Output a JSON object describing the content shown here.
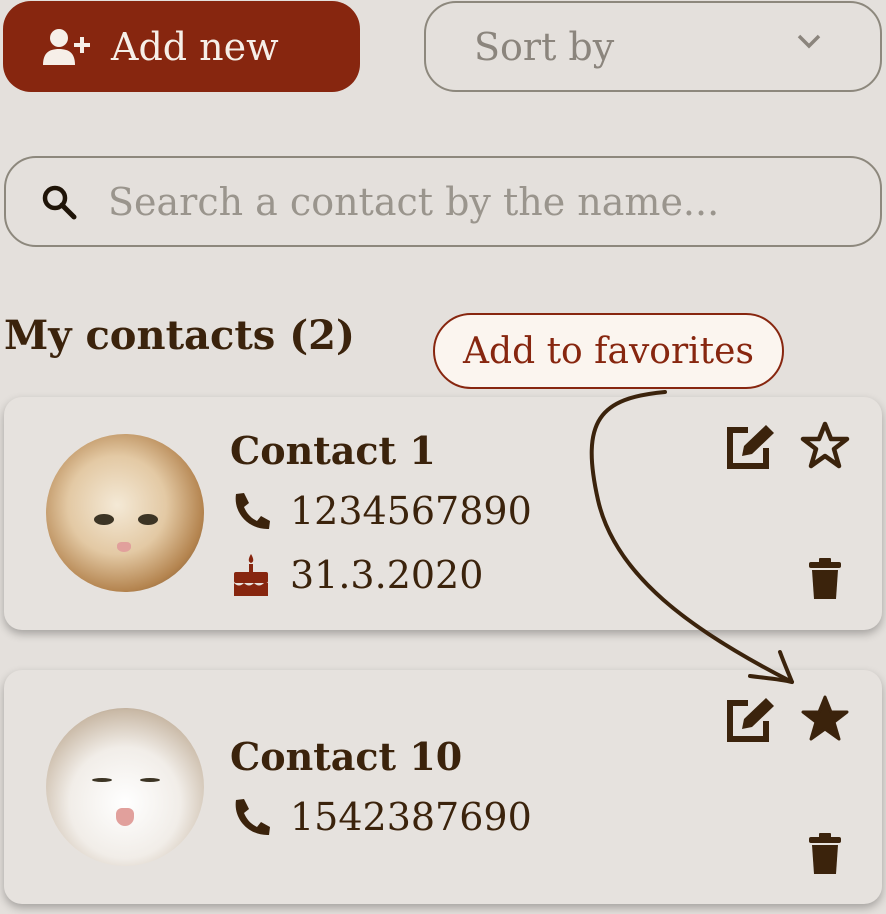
{
  "toolbar": {
    "add_label": "Add new",
    "sort_label": "Sort by"
  },
  "search": {
    "placeholder": "Search a contact by the name..."
  },
  "contacts_heading": "My contacts (2)",
  "tooltip": "Add to favorites",
  "contacts": [
    {
      "name": "Contact 1",
      "phone": "1234567890",
      "birthday": "31.3.2020",
      "favorite": false
    },
    {
      "name": "Contact 10",
      "phone": "1542387690",
      "favorite": true
    }
  ],
  "icons": {
    "add": "user-plus-icon",
    "sort": "chevron-down-icon",
    "search": "search-icon",
    "phone": "phone-icon",
    "birthday": "cake-icon",
    "edit": "edit-icon",
    "favorite": "star-icon",
    "delete": "trash-icon"
  },
  "colors": {
    "accent": "#87260f",
    "text": "#3b230c",
    "background": "#e4e0dc",
    "muted": "#8b857d"
  }
}
